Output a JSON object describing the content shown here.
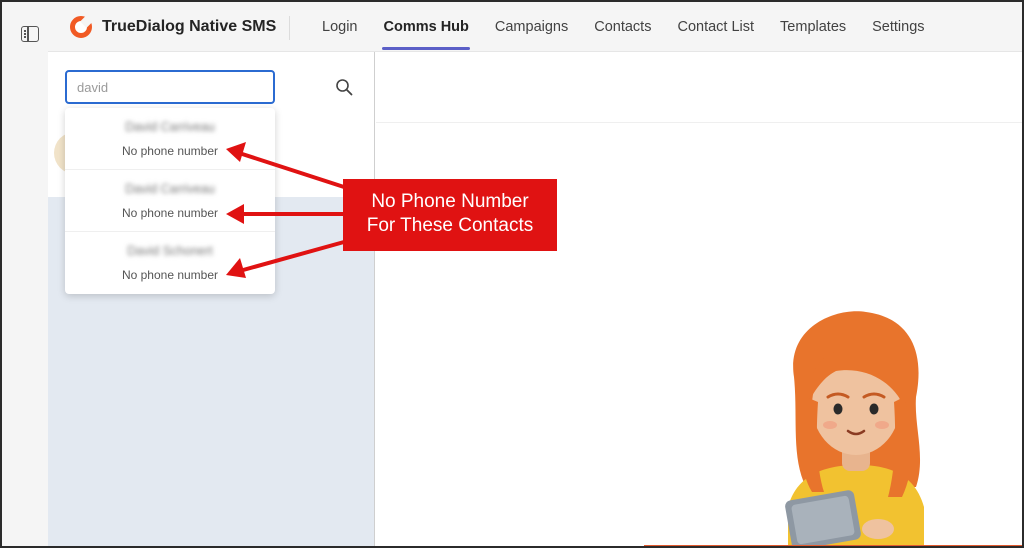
{
  "app": {
    "title": "TrueDialog Native SMS",
    "accent_color": "#5b5fc7",
    "brand_color": "#f15a24"
  },
  "nav": {
    "tabs": [
      {
        "label": "Login",
        "active": false
      },
      {
        "label": "Comms Hub",
        "active": true
      },
      {
        "label": "Campaigns",
        "active": false
      },
      {
        "label": "Contacts",
        "active": false
      },
      {
        "label": "Contact List",
        "active": false
      },
      {
        "label": "Templates",
        "active": false
      },
      {
        "label": "Settings",
        "active": false
      }
    ]
  },
  "search": {
    "value": "david",
    "icon": "search-icon"
  },
  "results": [
    {
      "name": "David Carriveau",
      "phone": "No phone number"
    },
    {
      "name": "David Carriveau",
      "phone": "No phone number"
    },
    {
      "name": "David Schonert",
      "phone": "No phone number"
    }
  ],
  "annotation": {
    "line1": "No Phone Number",
    "line2": "For These Contacts",
    "color": "#e01212"
  }
}
